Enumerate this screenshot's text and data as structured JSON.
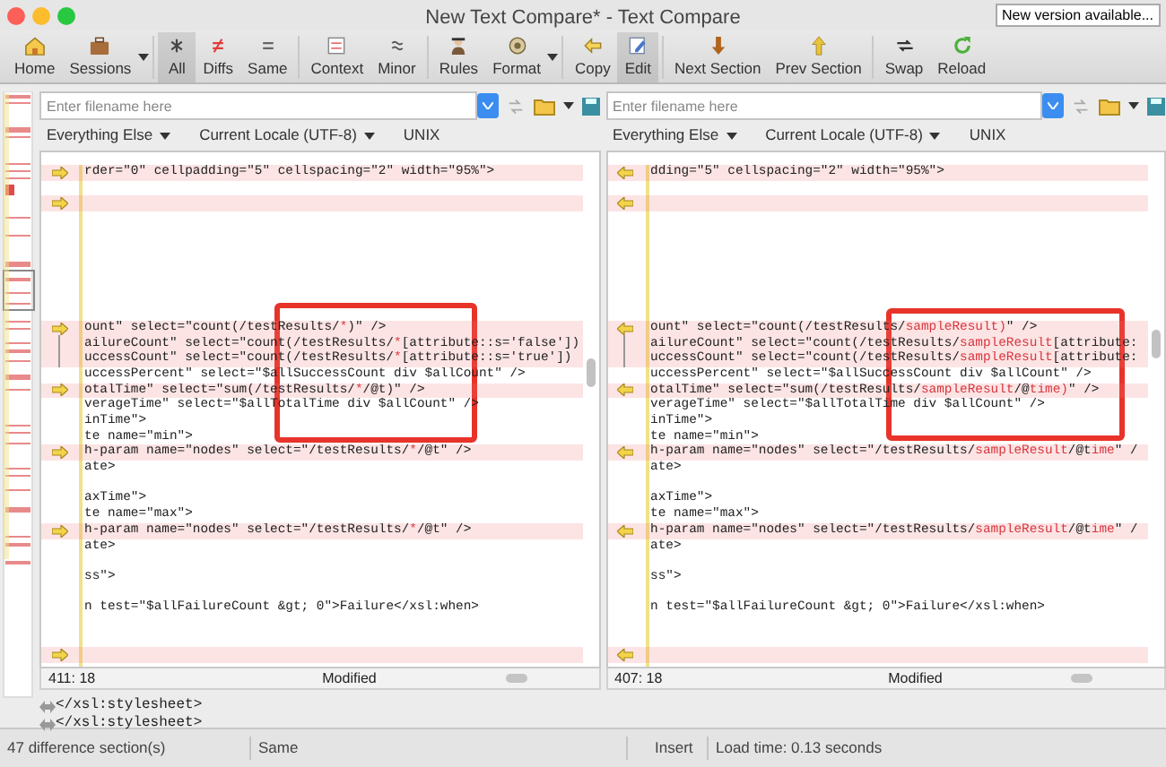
{
  "window": {
    "title": "New Text Compare* - Text Compare",
    "update_button": "New version available..."
  },
  "toolbar": [
    {
      "label": "Home",
      "pressed": false,
      "dropdown": false
    },
    {
      "label": "Sessions",
      "pressed": false,
      "dropdown": true
    },
    {
      "label": "All",
      "pressed": true,
      "dropdown": false
    },
    {
      "label": "Diffs",
      "pressed": false,
      "dropdown": false
    },
    {
      "label": "Same",
      "pressed": false,
      "dropdown": false
    },
    {
      "label": "Context",
      "pressed": false,
      "dropdown": false
    },
    {
      "label": "Minor",
      "pressed": false,
      "dropdown": false
    },
    {
      "label": "Rules",
      "pressed": false,
      "dropdown": false
    },
    {
      "label": "Format",
      "pressed": false,
      "dropdown": true
    },
    {
      "label": "Copy",
      "pressed": false,
      "dropdown": false
    },
    {
      "label": "Edit",
      "pressed": true,
      "dropdown": false
    },
    {
      "label": "Next Section",
      "pressed": false,
      "dropdown": false
    },
    {
      "label": "Prev Section",
      "pressed": false,
      "dropdown": false
    },
    {
      "label": "Swap",
      "pressed": false,
      "dropdown": false
    },
    {
      "label": "Reload",
      "pressed": false,
      "dropdown": false
    }
  ],
  "panes": [
    {
      "filename": {
        "placeholder": "Enter filename here"
      },
      "options": [
        "Everything Else",
        "Current Locale (UTF-8)"
      ],
      "line_ending": "UNIX",
      "position": "411: 18",
      "state": "Modified",
      "annotation_frame": true,
      "lines": [
        {
          "changed": true,
          "kind": "arrow",
          "text": "rder=\"0\" cellpadding=\"5\" cellspacing=\"2\" width=\"95%\">"
        },
        {
          "changed": false,
          "kind": "plain"
        },
        {
          "changed": true,
          "kind": "arrow"
        },
        {
          "changed": false,
          "kind": "plain"
        },
        {
          "changed": false,
          "kind": "plain"
        },
        {
          "changed": false,
          "kind": "plain"
        },
        {
          "changed": false,
          "kind": "plain"
        },
        {
          "changed": false,
          "kind": "plain"
        },
        {
          "changed": false,
          "kind": "plain"
        },
        {
          "changed": false,
          "kind": "plain"
        },
        {
          "changed": true,
          "kind": "arrow",
          "segments": [
            {
              "text": "ount\" select=\"count(/testResults/",
              "diff": false
            },
            {
              "text": "*",
              "diff": true
            },
            {
              "text": ")\" />",
              "diff": false
            }
          ]
        },
        {
          "changed": true,
          "kind": "bracket",
          "segments": [
            {
              "text": "ailureCount\" select=\"count(/testResults/",
              "diff": false
            },
            {
              "text": "*",
              "diff": true
            },
            {
              "text": "[attribute::s='false'])",
              "diff": false
            }
          ]
        },
        {
          "changed": true,
          "kind": "bracket",
          "segments": [
            {
              "text": "uccessCount\" select=\"count(/testResults/",
              "diff": false
            },
            {
              "text": "*",
              "diff": true
            },
            {
              "text": "[attribute::s='true'])",
              "diff": false
            }
          ]
        },
        {
          "changed": false,
          "kind": "plain",
          "text": "uccessPercent\" select=\"$allSuccessCount div $allCount\" />"
        },
        {
          "changed": true,
          "kind": "arrow",
          "segments": [
            {
              "text": "otalTime\" select=\"sum(/testResults/",
              "diff": false
            },
            {
              "text": "*",
              "diff": true
            },
            {
              "text": "/@t)\" />",
              "diff": false
            }
          ]
        },
        {
          "changed": false,
          "kind": "plain",
          "text": "verageTime\" select=\"$allTotalTime div $allCount\" />"
        },
        {
          "changed": false,
          "kind": "plain",
          "text": "inTime\">"
        },
        {
          "changed": false,
          "kind": "plain",
          "text": "te name=\"min\">"
        },
        {
          "changed": true,
          "kind": "arrow",
          "segments": [
            {
              "text": "h-param name=\"nodes\" select=\"/testResults/",
              "diff": false
            },
            {
              "text": "*",
              "diff": true
            },
            {
              "text": "/@t\" />",
              "diff": false
            }
          ]
        },
        {
          "changed": false,
          "kind": "plain",
          "text": "ate>"
        },
        {
          "changed": false,
          "kind": "plain"
        },
        {
          "changed": false,
          "kind": "plain",
          "text": "axTime\">"
        },
        {
          "changed": false,
          "kind": "plain",
          "text": "te name=\"max\">"
        },
        {
          "changed": true,
          "kind": "arrow",
          "segments": [
            {
              "text": "h-param name=\"nodes\" select=\"/testResults/",
              "diff": false
            },
            {
              "text": "*",
              "diff": true
            },
            {
              "text": "/@t\" />",
              "diff": false
            }
          ]
        },
        {
          "changed": false,
          "kind": "plain",
          "text": "ate>"
        },
        {
          "changed": false,
          "kind": "plain"
        },
        {
          "changed": false,
          "kind": "plain",
          "text": "ss\">"
        },
        {
          "changed": false,
          "kind": "plain"
        },
        {
          "changed": false,
          "kind": "plain",
          "text": "n test=\"$allFailureCount &gt; 0\">Failure</xsl:when>"
        },
        {
          "changed": false,
          "kind": "plain"
        },
        {
          "changed": false,
          "kind": "plain"
        },
        {
          "changed": true,
          "kind": "arrow"
        }
      ]
    },
    {
      "filename": {
        "placeholder": "Enter filename here"
      },
      "options": [
        "Everything Else",
        "Current Locale (UTF-8)"
      ],
      "line_ending": "UNIX",
      "position": "407: 18",
      "state": "Modified",
      "annotation_frame": true,
      "lines": [
        {
          "changed": true,
          "kind": "arrow",
          "text": "dding=\"5\" cellspacing=\"2\" width=\"95%\">"
        },
        {
          "changed": false,
          "kind": "plain"
        },
        {
          "changed": true,
          "kind": "arrow"
        },
        {
          "changed": false,
          "kind": "plain"
        },
        {
          "changed": false,
          "kind": "plain"
        },
        {
          "changed": false,
          "kind": "plain"
        },
        {
          "changed": false,
          "kind": "plain"
        },
        {
          "changed": false,
          "kind": "plain"
        },
        {
          "changed": false,
          "kind": "plain"
        },
        {
          "changed": false,
          "kind": "plain"
        },
        {
          "changed": true,
          "kind": "arrow",
          "segments": [
            {
              "text": "ount\" select=\"count(/testResults/",
              "diff": false
            },
            {
              "text": "sampleResult)",
              "diff": true
            },
            {
              "text": "\" />",
              "diff": false
            }
          ]
        },
        {
          "changed": true,
          "kind": "bracket",
          "segments": [
            {
              "text": "ailureCount\" select=\"count(/testResults/",
              "diff": false
            },
            {
              "text": "sampleResult",
              "diff": true
            },
            {
              "text": "[attribute:",
              "diff": false
            }
          ]
        },
        {
          "changed": true,
          "kind": "bracket",
          "segments": [
            {
              "text": "uccessCount\" select=\"count(/testResults/",
              "diff": false
            },
            {
              "text": "sampleResult",
              "diff": true
            },
            {
              "text": "[attribute:",
              "diff": false
            }
          ]
        },
        {
          "changed": false,
          "kind": "plain",
          "text": "uccessPercent\" select=\"$allSuccessCount div $allCount\" />"
        },
        {
          "changed": true,
          "kind": "arrow",
          "segments": [
            {
              "text": "otalTime\" select=\"sum(/testResults/",
              "diff": false
            },
            {
              "text": "sampleResult",
              "diff": true
            },
            {
              "text": "/@",
              "diff": false
            },
            {
              "text": "time)",
              "diff": true
            },
            {
              "text": "\" />",
              "diff": false
            }
          ]
        },
        {
          "changed": false,
          "kind": "plain",
          "text": "verageTime\" select=\"$allTotalTime div $allCount\" />"
        },
        {
          "changed": false,
          "kind": "plain",
          "text": "inTime\">"
        },
        {
          "changed": false,
          "kind": "plain",
          "text": "te name=\"min\">"
        },
        {
          "changed": true,
          "kind": "arrow",
          "segments": [
            {
              "text": "h-param name=\"nodes\" select=\"/testResults/",
              "diff": false
            },
            {
              "text": "sampleResult",
              "diff": true
            },
            {
              "text": "/@t",
              "diff": false
            },
            {
              "text": "ime",
              "diff": true
            },
            {
              "text": "\" /",
              "diff": false
            }
          ]
        },
        {
          "changed": false,
          "kind": "plain",
          "text": "ate>"
        },
        {
          "changed": false,
          "kind": "plain"
        },
        {
          "changed": false,
          "kind": "plain",
          "text": "axTime\">"
        },
        {
          "changed": false,
          "kind": "plain",
          "text": "te name=\"max\">"
        },
        {
          "changed": true,
          "kind": "arrow",
          "segments": [
            {
              "text": "h-param name=\"nodes\" select=\"/testResults/",
              "diff": false
            },
            {
              "text": "sampleResult",
              "diff": true
            },
            {
              "text": "/@t",
              "diff": false
            },
            {
              "text": "ime",
              "diff": true
            },
            {
              "text": "\" /",
              "diff": false
            }
          ]
        },
        {
          "changed": false,
          "kind": "plain",
          "text": "ate>"
        },
        {
          "changed": false,
          "kind": "plain"
        },
        {
          "changed": false,
          "kind": "plain",
          "text": "ss\">"
        },
        {
          "changed": false,
          "kind": "plain"
        },
        {
          "changed": false,
          "kind": "plain",
          "text": "n test=\"$allFailureCount &gt; 0\">Failure</xsl:when>"
        },
        {
          "changed": false,
          "kind": "plain"
        },
        {
          "changed": false,
          "kind": "plain"
        },
        {
          "changed": true,
          "kind": "arrow"
        }
      ]
    }
  ],
  "merged_lines": [
    "</xsl:stylesheet>",
    "</xsl:stylesheet>"
  ],
  "status_bar": [
    "47 difference section(s)",
    "Same",
    "Insert",
    "Load time: 0.13 seconds"
  ]
}
